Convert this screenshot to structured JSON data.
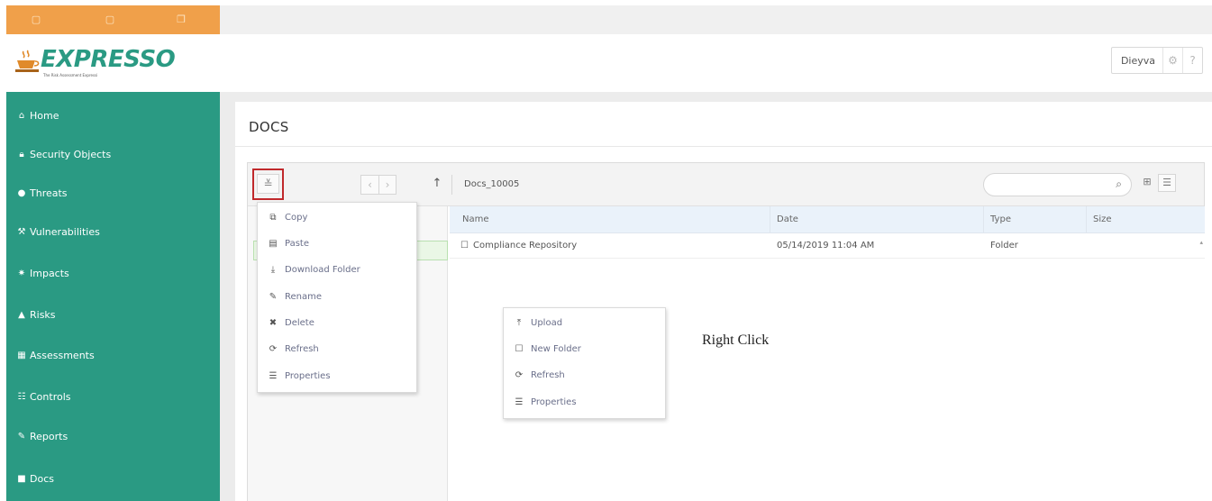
{
  "app": {
    "logo_text": "EXPRESSO",
    "logo_tagline": "The Risk Assessment Expressi",
    "user_name": "Dieyva"
  },
  "sidebar": {
    "items": [
      {
        "label": "Home",
        "icon": "home-icon"
      },
      {
        "label": "Security Objects",
        "icon": "lock-icon"
      },
      {
        "label": "Threats",
        "icon": "threat-icon"
      },
      {
        "label": "Vulnerabilities",
        "icon": "wrench-icon"
      },
      {
        "label": "Impacts",
        "icon": "impact-icon"
      },
      {
        "label": "Risks",
        "icon": "warning-icon"
      },
      {
        "label": "Assessments",
        "icon": "assessment-icon"
      },
      {
        "label": "Controls",
        "icon": "sliders-icon"
      },
      {
        "label": "Reports",
        "icon": "report-icon"
      },
      {
        "label": "Docs",
        "icon": "folder-icon"
      }
    ]
  },
  "page": {
    "title": "DOCS"
  },
  "toolbar": {
    "breadcrumb": "Docs_10005",
    "search_placeholder": ""
  },
  "file_list": {
    "columns": [
      "Name",
      "Date",
      "Type",
      "Size"
    ],
    "rows": [
      {
        "name": "Compliance Repository",
        "date": "05/14/2019 11:04 AM",
        "type": "Folder",
        "size": ""
      }
    ]
  },
  "folder_context_menu": {
    "items": [
      {
        "label": "Copy",
        "icon": "copy-icon"
      },
      {
        "label": "Paste",
        "icon": "paste-icon"
      },
      {
        "label": "Download Folder",
        "icon": "download-icon"
      },
      {
        "label": "Rename",
        "icon": "edit-icon"
      },
      {
        "label": "Delete",
        "icon": "delete-icon"
      },
      {
        "label": "Refresh",
        "icon": "refresh-icon"
      },
      {
        "label": "Properties",
        "icon": "list-icon"
      }
    ]
  },
  "area_context_menu": {
    "items": [
      {
        "label": "Upload",
        "icon": "upload-icon"
      },
      {
        "label": "New Folder",
        "icon": "folder-outline-icon"
      },
      {
        "label": "Refresh",
        "icon": "refresh-icon"
      },
      {
        "label": "Properties",
        "icon": "list-icon"
      }
    ]
  },
  "annotation": {
    "text": "Right Click"
  },
  "colors": {
    "sidebar_bg": "#2a9a83",
    "orange_bar": "#f0a04a",
    "highlight_border": "#c0292c",
    "selected_node": "#eaf7e6"
  }
}
